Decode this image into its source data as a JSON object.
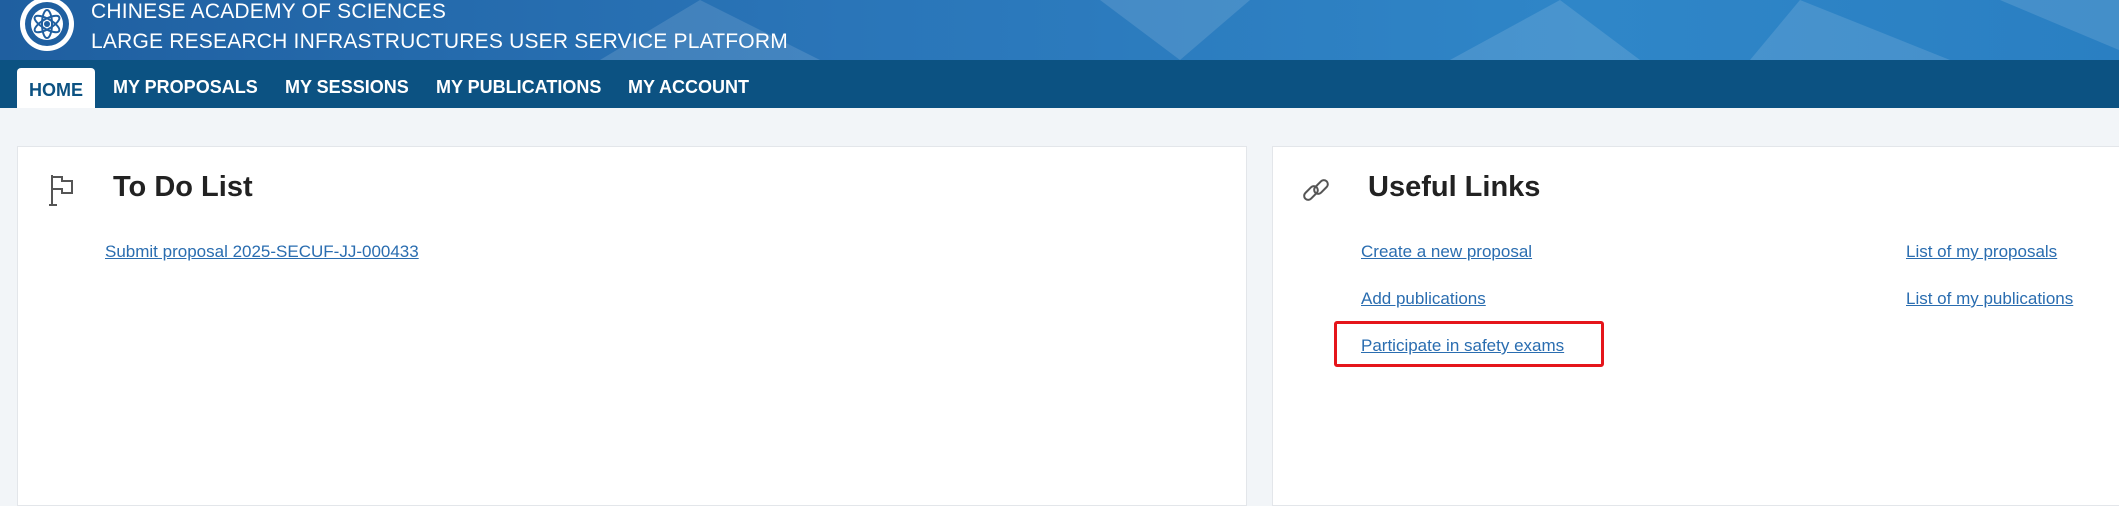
{
  "header": {
    "org_name": "CHINESE ACADEMY OF SCIENCES",
    "platform_name": "LARGE RESEARCH INFRASTRUCTURES USER SERVICE PLATFORM"
  },
  "nav": {
    "items": [
      {
        "label": "HOME",
        "active": true
      },
      {
        "label": "MY PROPOSALS",
        "active": false
      },
      {
        "label": "MY SESSIONS",
        "active": false
      },
      {
        "label": "MY PUBLICATIONS",
        "active": false
      },
      {
        "label": "MY ACCOUNT",
        "active": false
      }
    ]
  },
  "todo": {
    "title": "To Do List",
    "icon": "flag-icon",
    "items": [
      "Submit proposal 2025-SECUF-JJ-000433"
    ]
  },
  "useful_links": {
    "title": "Useful Links",
    "icon": "link-icon",
    "left": [
      "Create a new proposal",
      "Add publications",
      "Participate in safety exams"
    ],
    "right": [
      "List of my proposals",
      "List of my publications"
    ]
  },
  "colors": {
    "nav_bg": "#0c5282",
    "link": "#2a6db0",
    "highlight": "#e5151b"
  }
}
